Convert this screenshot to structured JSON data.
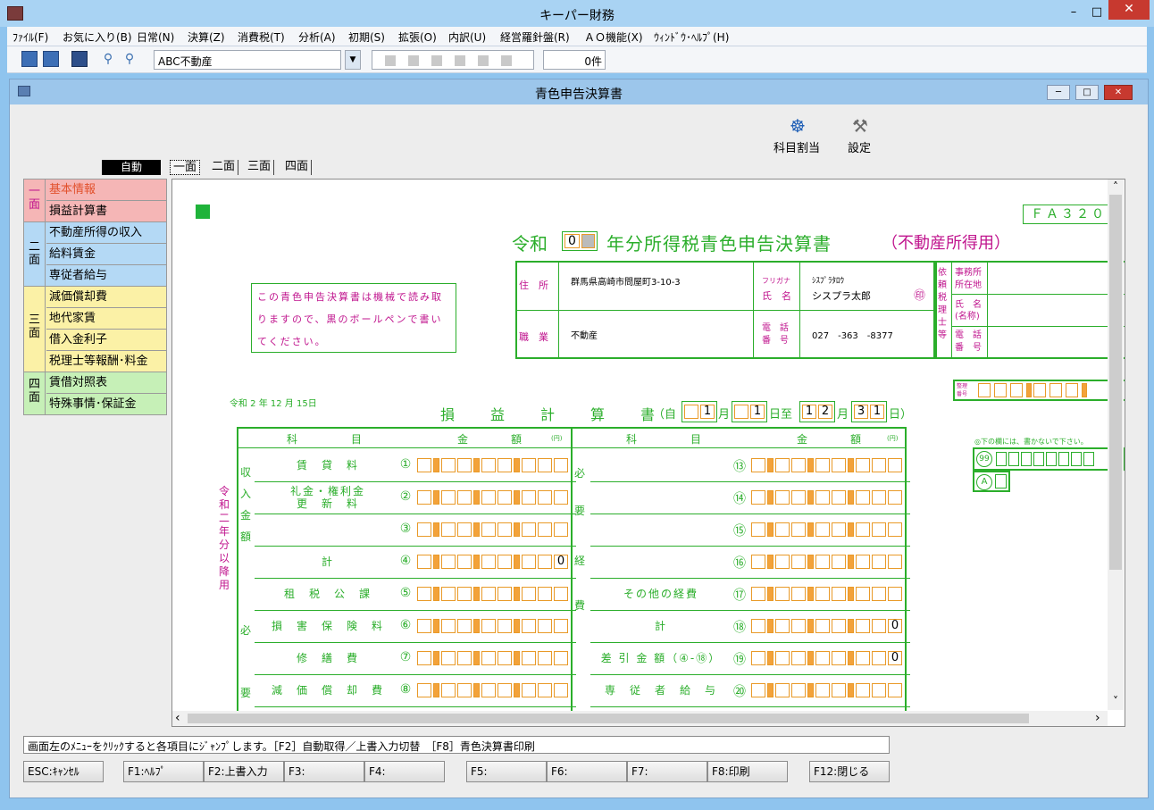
{
  "app": {
    "title": "キーパー財務",
    "min": "–",
    "max": "□",
    "close": "✕"
  },
  "menu": [
    "ﾌｧｲﾙ(F)",
    "お気に入り(B)",
    "日常(N)",
    "決算(Z)",
    "消費税(T)",
    "分析(A)",
    "初期(S)",
    "拡張(O)",
    "内訳(U)",
    "経営羅針盤(R)",
    "ＡＯ機能(X)",
    "ｳｨﾝﾄﾞｳ･ﾍﾙﾌﾟ(H)"
  ],
  "toolbar": {
    "combo_value": "ABC不動産",
    "combo_arrow": "▼",
    "count": "0件"
  },
  "child": {
    "title": "青色申告決算書",
    "min": "─",
    "max": "□",
    "close": "✕"
  },
  "big_buttons": {
    "assign": "科目割当",
    "settings": "設定",
    "assign_icon": "☸",
    "settings_icon": "⚒"
  },
  "auto_label": "自動",
  "tabs": [
    "一面",
    "二面",
    "三面",
    "四面"
  ],
  "nav": {
    "g1": {
      "label": "一\n面",
      "items": [
        "基本情報",
        "損益計算書"
      ]
    },
    "g2": {
      "label": "二\n面",
      "items": [
        "不動産所得の収入",
        "給料賃金",
        "専従者給与"
      ]
    },
    "g3": {
      "label": "三\n面",
      "items": [
        "減価償却費",
        "地代家賃",
        "借入金利子",
        "税理士等報酬･料金"
      ]
    },
    "g4": {
      "label": "四\n面",
      "items": [
        "賃借対照表",
        "特殊事情･保証金"
      ]
    }
  },
  "form": {
    "code": "ＦＡ３２０",
    "title_pre": "令和",
    "year_digit": "0",
    "title_post": "年分所得税青色申告決算書",
    "title_sub": "（不動産所得用）",
    "notice": "この青色申告決算書は機械で読み取りますので、黒のボールペンで書いてください。",
    "addr_label": "住　所",
    "addr_value": "群馬県高崎市問屋町3-10-3",
    "furigana_label": "フリガナ",
    "name_label": "氏　名",
    "furigana_value": "ｼｽﾌﾟﾗﾀﾛｳ",
    "name_value": "シスプラ太郎",
    "seal": "㊞",
    "job_label": "職　業",
    "job_value": "不動産",
    "tel_label": "電　話\n番　号",
    "tel_value": "027　-363　-8377",
    "agent_label": "依頼税理士等",
    "office_label": "事務所\n所在地",
    "agent_name_label": "氏　名\n(名称)",
    "agent_tel_label": "電　話\n番　号",
    "mgmt_label": "整理\n番号",
    "date_line": "令和 2 年 12 月 15日",
    "pl_title": "損　益　計　算　書",
    "period_pre": "（自",
    "month": "月",
    "day_to": "日至",
    "day": "日",
    "period_post": "日）",
    "from_m": "1",
    "from_d": "1",
    "to_m1": "1",
    "to_m2": "2",
    "to_d1": "3",
    "to_d2": "1",
    "col_subject": "科　　　　　目",
    "col_amount": "金　　　　額",
    "yen": "(円)",
    "side_vertical": "令和二年分以降用",
    "note_right": "◎下の欄には、書かないで下さい。",
    "n99": "99",
    "nA": "A",
    "left_groups": [
      "収入金額",
      "必要"
    ],
    "right_groups": [
      "必",
      "要",
      "経",
      "費"
    ],
    "rows_left": [
      {
        "no": "①",
        "label": "賃　貸　料",
        "value": ""
      },
      {
        "no": "②",
        "label": "礼金・権利金\n更　新　料",
        "value": ""
      },
      {
        "no": "③",
        "label": "",
        "value": ""
      },
      {
        "no": "④",
        "label": "計",
        "value": "0"
      },
      {
        "no": "⑤",
        "label": "租　税　公　課",
        "value": ""
      },
      {
        "no": "⑥",
        "label": "損　害　保　険　料",
        "value": ""
      },
      {
        "no": "⑦",
        "label": "修　繕　費",
        "value": ""
      },
      {
        "no": "⑧",
        "label": "減　価　償　却　費",
        "value": ""
      }
    ],
    "rows_right": [
      {
        "no": "⑬",
        "label": "",
        "value": ""
      },
      {
        "no": "⑭",
        "label": "",
        "value": ""
      },
      {
        "no": "⑮",
        "label": "",
        "value": ""
      },
      {
        "no": "⑯",
        "label": "",
        "value": ""
      },
      {
        "no": "⑰",
        "label": "その他の経費",
        "value": ""
      },
      {
        "no": "⑱",
        "label": "計",
        "value": "0"
      },
      {
        "no": "⑲",
        "label": "差 引 金 額（④-⑱）",
        "value": "0"
      },
      {
        "no": "⑳",
        "label": "専　従　者　給　与",
        "value": ""
      }
    ]
  },
  "scroll": {
    "up": "˄",
    "down": "˅",
    "left": "‹",
    "right": "›"
  },
  "status_text": "画面左のﾒﾆｭｰをｸﾘｯｸすると各項目にｼﾞｬﾝﾌﾟします。［F2］自動取得／上書入力切替　［F8］青色決算書印刷",
  "fkeys": [
    "ESC:ｷｬﾝｾﾙ",
    "F1:ﾍﾙﾌﾟ",
    "F2:上書入力",
    "F3:",
    "F4:",
    "F5:",
    "F6:",
    "F7:",
    "F8:印刷",
    "F12:閉じる"
  ]
}
